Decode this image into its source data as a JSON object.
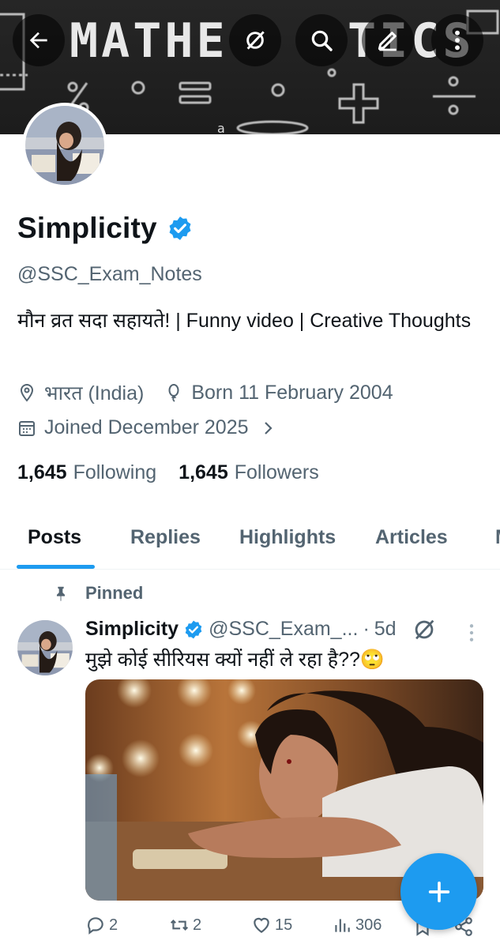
{
  "banner": {
    "text_left": "MATHE",
    "text_right": "TICS",
    "alt": "MATHEMATICS chalkboard"
  },
  "top_bar": {
    "icons": [
      "back-arrow-icon",
      "grok-icon",
      "search-icon",
      "edit-icon",
      "more-vertical-icon"
    ]
  },
  "profile": {
    "name": "Simplicity",
    "handle": "@SSC_Exam_Notes",
    "bio": "मौन व्रत सदा सहायते! | Funny video | Creative Thoughts",
    "location": "भारत (India)",
    "born": "Born 11 February 2004",
    "joined": "Joined December 2025",
    "following_count": "1,645",
    "following_label": "Following",
    "followers_count": "1,645",
    "followers_label": "Followers",
    "verified_color": "#1d9bf0"
  },
  "tabs": [
    {
      "label": "Posts",
      "active": true
    },
    {
      "label": "Replies"
    },
    {
      "label": "Highlights"
    },
    {
      "label": "Articles"
    },
    {
      "label": "M"
    }
  ],
  "tweet": {
    "pinned_label": "Pinned",
    "name": "Simplicity",
    "handle": "@SSC_Exam_...",
    "dot": "·",
    "time": "5d",
    "text": "मुझे कोई सीरियस क्यों नहीं ले रहा है??🙄",
    "replies": "2",
    "reposts": "2",
    "likes": "15",
    "views": "306"
  },
  "colors": {
    "accent": "#1d9bf0",
    "text_primary": "#0f1419",
    "text_secondary": "#536471"
  }
}
